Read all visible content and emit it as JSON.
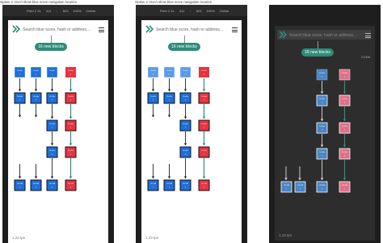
{
  "captions": {
    "left": "Option 2: Don't show blue score navigation location",
    "middle": "Option 2: Don't show blue score navigation location"
  },
  "device_bar": {
    "device": "Pixel 2 XL",
    "width": "411",
    "height": "823",
    "zoom": "100%",
    "network": "Online"
  },
  "app": {
    "search_placeholder": "Search blue score, hash or address...",
    "new_blocks_label": "16 new blocks",
    "tps_label": "1.23 tps",
    "blue_score_label": "21066"
  },
  "blocks": {
    "label": "11c66e",
    "bottom_label": "101388",
    "index_labels": [
      "2",
      "4",
      "1"
    ]
  },
  "colors": {
    "blue": "#1e6fd9",
    "red": "#e63440",
    "teal": "#2e8c7a",
    "dark_bg": "#2d2d2d",
    "panel_bg": "#1e1e1e"
  }
}
